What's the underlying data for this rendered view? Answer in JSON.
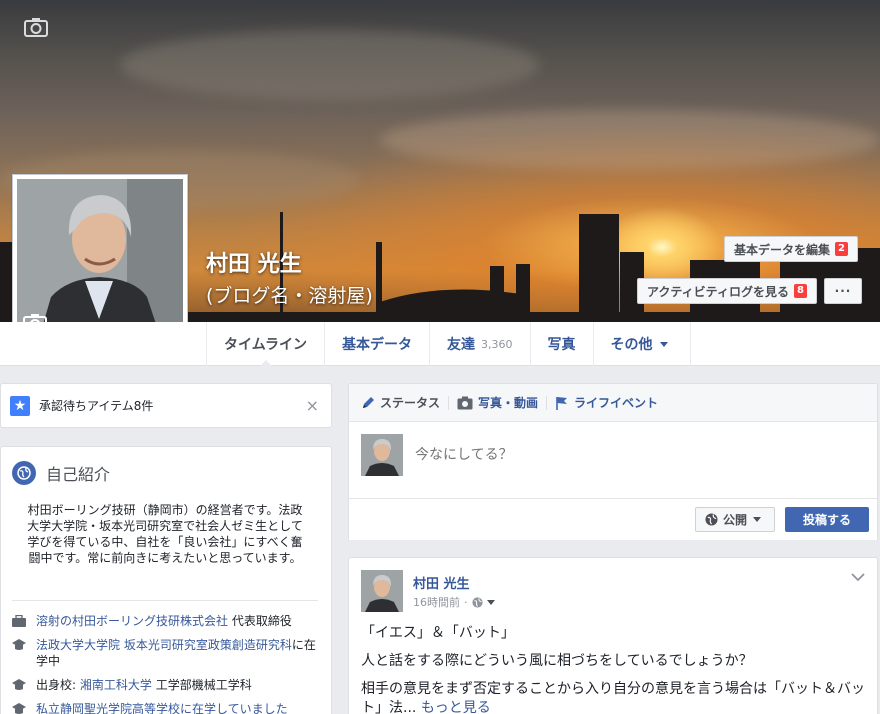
{
  "profile": {
    "name": "村田 光生",
    "subname": "(ブログ名・溶射屋)"
  },
  "cover_actions": {
    "edit_basic": "基本データを編集",
    "edit_basic_badge": "2",
    "activity_log": "アクティビティログを見る",
    "activity_log_badge": "8",
    "more": "···"
  },
  "nav": {
    "tabs": [
      {
        "label": "タイムライン",
        "count": ""
      },
      {
        "label": "基本データ",
        "count": ""
      },
      {
        "label": "友達",
        "count": "3,360"
      },
      {
        "label": "写真",
        "count": ""
      },
      {
        "label": "その他",
        "count": ""
      }
    ]
  },
  "pending": {
    "label": "承認待ちアイテム8件",
    "close": "×"
  },
  "intro": {
    "title": "自己紹介",
    "bio": "村田ボーリング技研（静岡市）の経営者です。法政大学大学院・坂本光司研究室で社会人ゼミ生として学びを得ている中、自社を「良い会社」にすべく奮闘中です。常に前向きに考えたいと思っています。",
    "items": [
      {
        "icon": "briefcase-icon",
        "link": "溶射の村田ボーリング技研株式会社",
        "text": " 代表取締役"
      },
      {
        "icon": "graduation-cap-icon",
        "link": "法政大学大学院 坂本光司研究室政策創造研究科",
        "text": "に在学中"
      },
      {
        "icon": "graduation-cap-icon",
        "prefix": "出身校: ",
        "link": "湘南工科大学",
        "text": " 工学部機械工学科"
      },
      {
        "icon": "graduation-cap-icon",
        "link": "私立静岡聖光学院高等学校に在学していました",
        "text": ""
      }
    ]
  },
  "composer": {
    "tabs": [
      {
        "icon": "pencil-icon",
        "label": "ステータス"
      },
      {
        "icon": "camera-icon",
        "label": "写真・動画"
      },
      {
        "icon": "flag-icon",
        "label": "ライフイベント"
      }
    ],
    "placeholder": "今なにしてる？",
    "audience": "公開",
    "post_button": "投稿する"
  },
  "post": {
    "author": "村田 光生",
    "time": "16時間前",
    "paragraphs": [
      "「イエス」＆「バット」",
      "人と話をする際にどういう風に相づちをしているでしょうか？",
      "相手の意見をまず否定することから入り自分の意見を言う場合は「バット＆バット」法..."
    ],
    "see_more": "もっと見る"
  },
  "colors": {
    "link": "#365899",
    "primary": "#4267b2",
    "badge": "#fa3e3e",
    "background": "#e9ebee"
  }
}
